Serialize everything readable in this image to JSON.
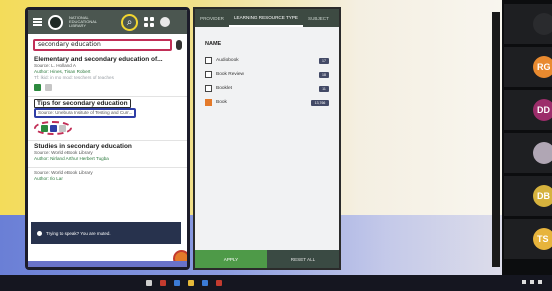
{
  "search": {
    "query": "secondary education"
  },
  "phone": {
    "logo_text": "NATIONAL EDUCATIONAL LIBRARY",
    "results": [
      {
        "title": "Elementary and secondary education of...",
        "source": "Source: L. Holland A",
        "author": "Author: Hines, Tisan Robert",
        "extra": "Tf: lkid: in mo mod: teschers of teaches"
      },
      {
        "title": "Tips for secondary education",
        "source": "Source: Unebura Insitute of Testing and Curr...",
        "author": "",
        "extra": ""
      },
      {
        "title": "Studies in secondary education",
        "source": "Source: World eBook Library",
        "author": "Author: Nirland Arthur Herbert Tugba",
        "extra": ""
      },
      {
        "title": "",
        "source": "Source: World eBook Library",
        "author": "Author: Ilo Lar",
        "extra": ""
      }
    ],
    "toast": "Trying to speak? You are muted."
  },
  "filter": {
    "tabs": [
      "PROVIDER",
      "LEARNING RESOURCE TYPE",
      "SUBJECT"
    ],
    "active_tab": "LEARNING RESOURCE TYPE",
    "heading": "NAME",
    "items": [
      {
        "label": "Audiobook",
        "count": "17",
        "checked": false
      },
      {
        "label": "Book Review",
        "count": "18",
        "checked": false
      },
      {
        "label": "Booklet",
        "count": "11",
        "checked": false
      },
      {
        "label": "Book",
        "count": "13,766",
        "checked": true
      }
    ],
    "apply_label": "APPLY",
    "reset_label": "RESET ALL"
  },
  "participants": [
    {
      "initials": "",
      "color": "#2a2b2e"
    },
    {
      "initials": "RG",
      "color": "#e98a2f"
    },
    {
      "initials": "DD",
      "color": "#9c2d6a"
    },
    {
      "initials": "",
      "color": "#b0a6b4"
    },
    {
      "initials": "DB",
      "color": "#d6b23d"
    },
    {
      "initials": "TS",
      "color": "#e7b43c"
    }
  ],
  "colors": {
    "accent": "#e47a2a",
    "highlight_red": "#c12f57",
    "highlight_blue": "#2f3ea6",
    "header_green": "#4b5650"
  }
}
